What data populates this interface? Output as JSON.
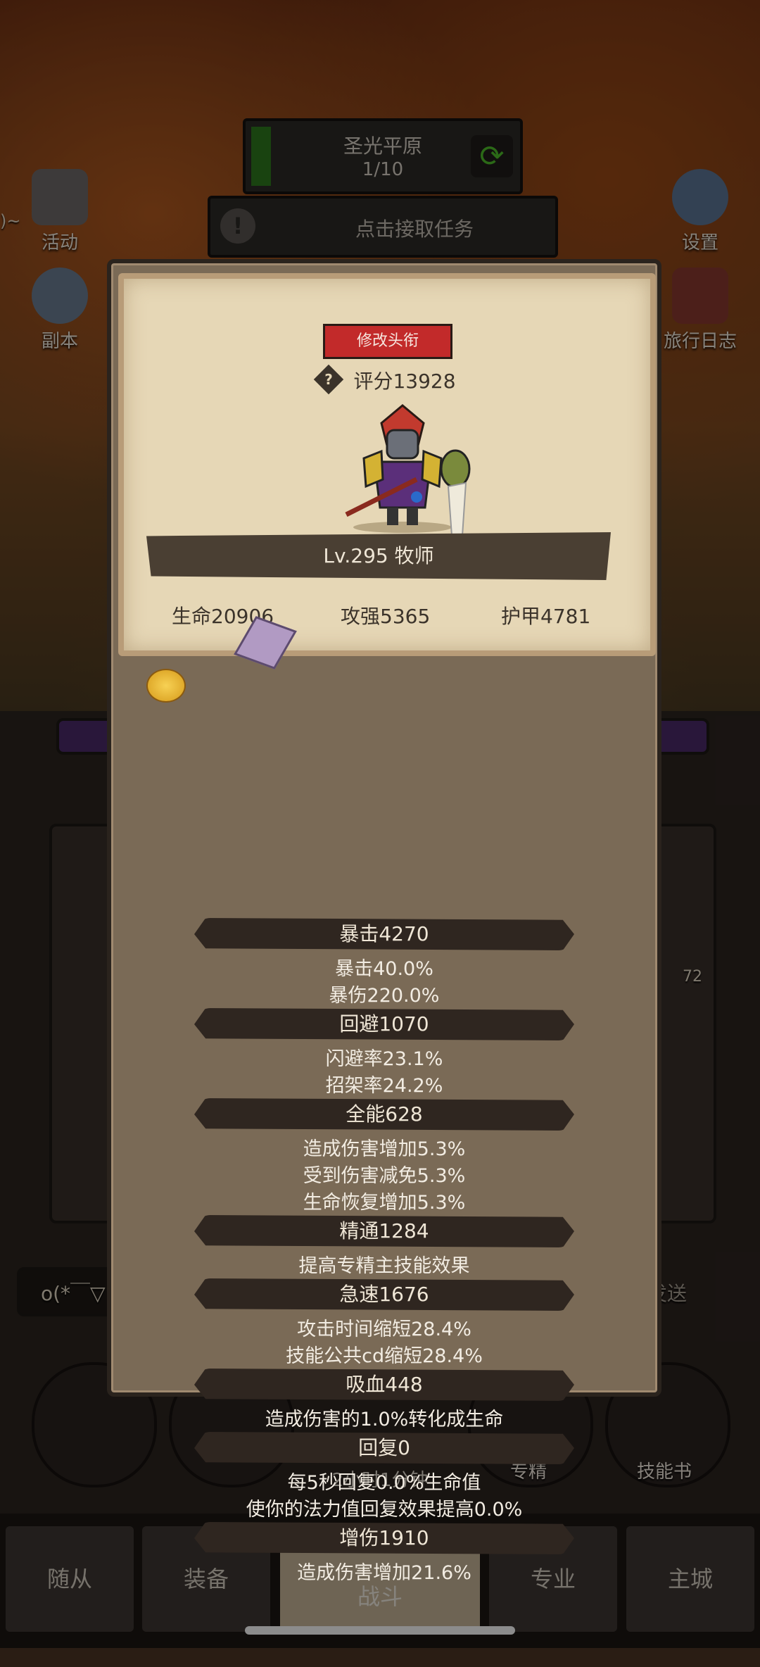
{
  "top": {
    "map_name": "圣光平原",
    "map_progress": "1/10",
    "quest_prompt": "点击接取任务",
    "quest_icon_glyph": "!",
    "refresh_glyph": "⟳"
  },
  "side_buttons": {
    "left": [
      {
        "label": "活动",
        "icon": "scroll-icon"
      },
      {
        "label": "副本",
        "icon": "portal-icon"
      }
    ],
    "right": [
      {
        "label": "设置",
        "icon": "gear-icon"
      },
      {
        "label": "旅行日志",
        "icon": "book-icon"
      }
    ]
  },
  "background": {
    "chat_prefix": "o(*￣▽",
    "send_label": "发送",
    "inventory_count": "72",
    "timer_prefix": "2小时1",
    "timer_suffix": "分钟",
    "spec_label": "专精",
    "skillbook_label": "技能书",
    "left_edge_label": ")~"
  },
  "profile": {
    "edit_title_button": "修改头衔",
    "help_glyph": "?",
    "score": "评分13928",
    "level_class": "Lv.295 牧师",
    "hp": "生命20906",
    "attack": "攻强5365",
    "armor": "护甲4781"
  },
  "stats": [
    {
      "header": "暴击4270",
      "lines": [
        "暴击40.0%",
        "暴伤220.0%"
      ]
    },
    {
      "header": "回避1070",
      "lines": [
        "闪避率23.1%",
        "招架率24.2%"
      ]
    },
    {
      "header": "全能628",
      "lines": [
        "造成伤害增加5.3%",
        "受到伤害减免5.3%",
        "生命恢复增加5.3%"
      ]
    },
    {
      "header": "精通1284",
      "lines": [
        "提高专精主技能效果"
      ]
    },
    {
      "header": "急速1676",
      "lines": [
        "攻击时间缩短28.4%",
        "技能公共cd缩短28.4%"
      ]
    },
    {
      "header": "吸血448",
      "lines": [
        "造成伤害的1.0%转化成生命"
      ]
    },
    {
      "header": "回复0",
      "lines": [
        "每5秒回复0.0%生命值",
        "使你的法力值回复效果提高0.0%"
      ]
    },
    {
      "header": "增伤1910",
      "lines": [
        "造成伤害增加21.6%"
      ]
    }
  ],
  "nav": {
    "tabs": [
      "随从",
      "装备",
      "战斗",
      "专业",
      "主城"
    ],
    "active": "战斗",
    "badge_glyph": "!"
  },
  "colors": {
    "edit_button": "#c22a2a",
    "card_bg": "#e6d7b6",
    "modal_bg": "#7a6a56",
    "stat_header_bg": "#2f2620",
    "badge_green": "#5bb13a"
  }
}
